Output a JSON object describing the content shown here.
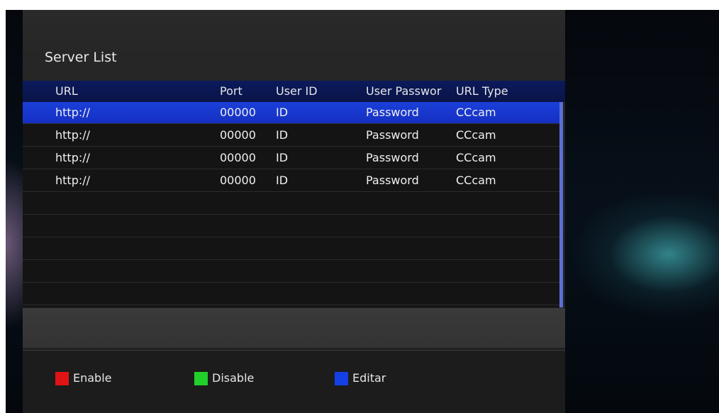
{
  "title": "Server List",
  "columns": {
    "url": "URL",
    "port": "Port",
    "user_id": "User ID",
    "password": "User Passwor",
    "url_type": "URL Type"
  },
  "rows": [
    {
      "url": "http://",
      "port": "00000",
      "user_id": "ID",
      "password": "Password",
      "url_type": "CCcam",
      "selected": true
    },
    {
      "url": "http://",
      "port": "00000",
      "user_id": "ID",
      "password": "Password",
      "url_type": "CCcam",
      "selected": false
    },
    {
      "url": "http://",
      "port": "00000",
      "user_id": "ID",
      "password": "Password",
      "url_type": "CCcam",
      "selected": false
    },
    {
      "url": "http://",
      "port": "00000",
      "user_id": "ID",
      "password": "Password",
      "url_type": "CCcam",
      "selected": false
    }
  ],
  "footer": {
    "enable": {
      "label": "Enable",
      "color": "#e01414"
    },
    "disable": {
      "label": "Disable",
      "color": "#22d02a"
    },
    "edit": {
      "label": "Editar",
      "color": "#1440e6"
    }
  }
}
